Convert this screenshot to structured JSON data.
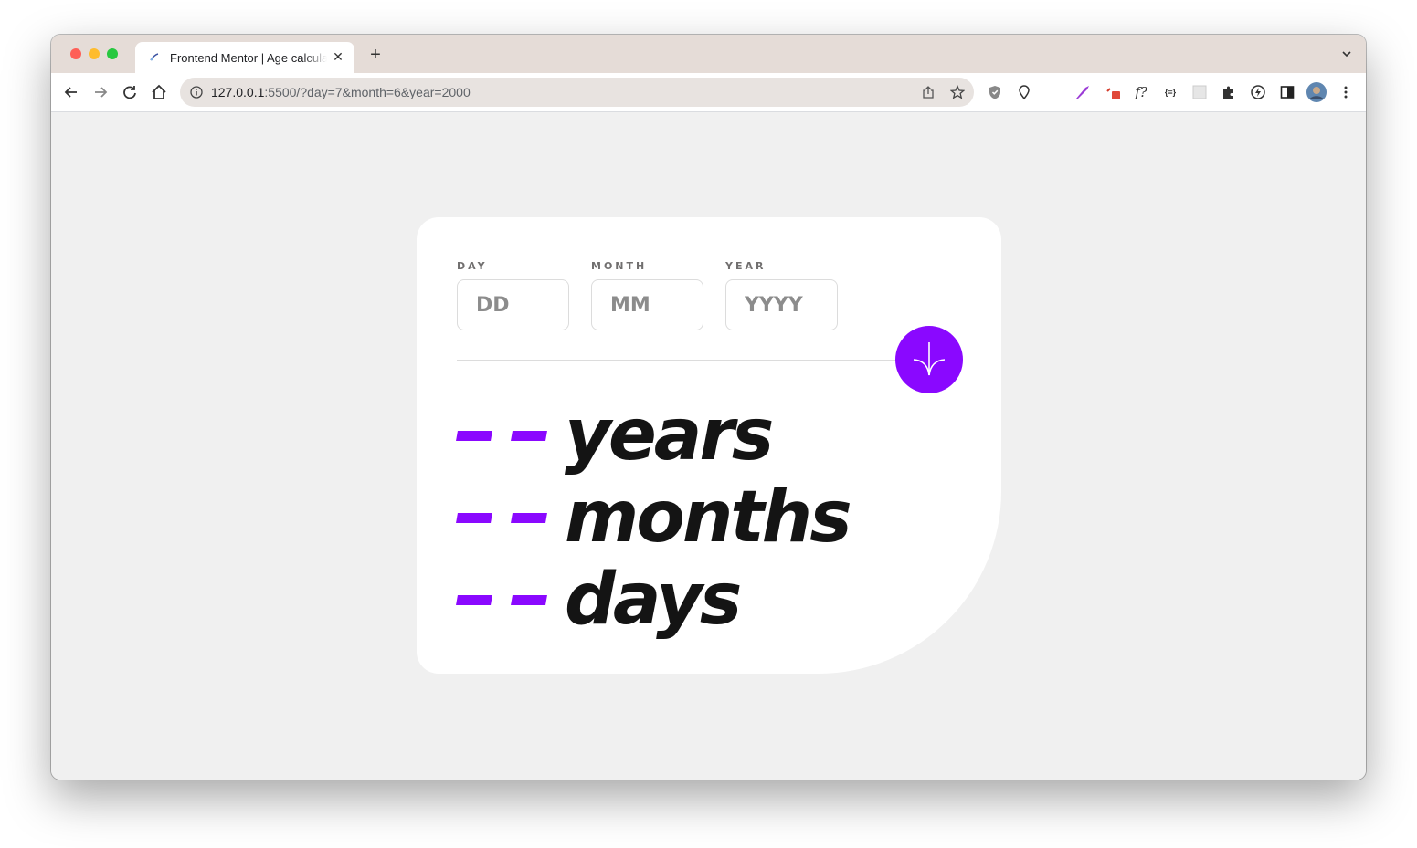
{
  "browser": {
    "tab_title": "Frontend Mentor | Age calculator app",
    "tab_close": "✕",
    "new_tab": "+",
    "url_host": "127.0.0.1",
    "url_rest": ":5500/?day=7&month=6&year=2000",
    "ext_icons": [
      "shield-icon",
      "location-icon",
      "pen-icon",
      "red-ext-icon",
      "font-ext-icon",
      "json-ext-icon",
      "grid-ext-icon",
      "puzzle-icon",
      "bolt-icon",
      "sidepanel-icon",
      "avatar",
      "menu-icon"
    ],
    "font_ext_label": "f?",
    "json_ext_label": "{≡}"
  },
  "form": {
    "day_label": "DAY",
    "day_placeholder": "DD",
    "month_label": "MONTH",
    "month_placeholder": "MM",
    "year_label": "YEAR",
    "year_placeholder": "YYYY"
  },
  "results": {
    "years_label": "years",
    "months_label": "months",
    "days_label": "days"
  },
  "colors": {
    "accent": "#8a08ff",
    "text": "#141414",
    "background": "#f0f0f0"
  }
}
